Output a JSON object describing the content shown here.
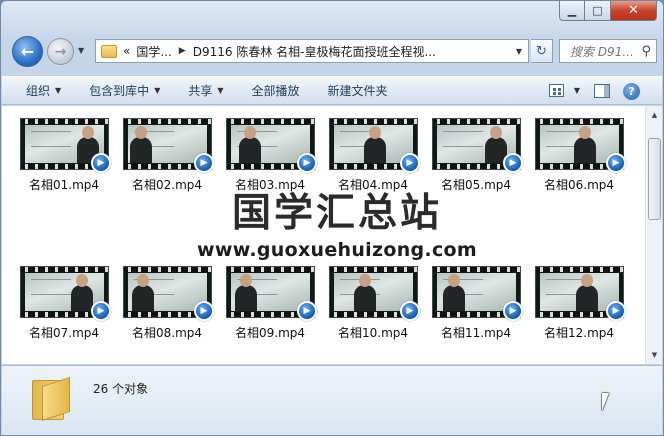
{
  "window": {
    "minimize_glyph": "▁",
    "maximize_glyph": "□",
    "close_glyph": "✕"
  },
  "nav": {
    "back_glyph": "←",
    "forward_glyph": "→",
    "history_glyph": "▼",
    "address": {
      "overflow": "«",
      "crumb1": "国学...",
      "crumb2": "D9116 陈春林 名相-皇极梅花面授班全程视...",
      "sep": "▶",
      "drop": "▼"
    },
    "refresh_glyph": "↻",
    "search_placeholder": "搜索 D91...",
    "search_icon": "⚲"
  },
  "commands": {
    "organize": "组织",
    "include_in_library": "包含到库中",
    "share": "共享",
    "play_all": "全部播放",
    "new_folder": "新建文件夹",
    "dropdown_glyph": "▼",
    "help_glyph": "?"
  },
  "files": [
    {
      "name": "名相01.mp4"
    },
    {
      "name": "名相02.mp4"
    },
    {
      "name": "名相03.mp4"
    },
    {
      "name": "名相04.mp4"
    },
    {
      "name": "名相05.mp4"
    },
    {
      "name": "名相06.mp4"
    },
    {
      "name": "名相07.mp4"
    },
    {
      "name": "名相08.mp4"
    },
    {
      "name": "名相09.mp4"
    },
    {
      "name": "名相10.mp4"
    },
    {
      "name": "名相11.mp4"
    },
    {
      "name": "名相12.mp4"
    }
  ],
  "watermark": {
    "title": "国学汇总站",
    "url": "www.guoxuehuizong.com"
  },
  "scroll": {
    "up_glyph": "▲",
    "down_glyph": "▼"
  },
  "details": {
    "object_count": "26 个对象"
  },
  "colors": {
    "media_badge": "#1560b8",
    "close_button": "#c7442a"
  }
}
